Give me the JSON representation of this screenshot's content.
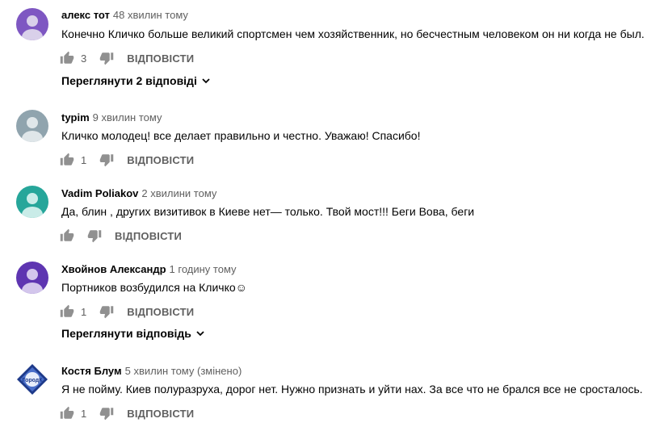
{
  "comments": [
    {
      "author": "алекс тот",
      "time": "48 хвилин тому",
      "edited": "",
      "text": "Конечно Кличко больше великий спортсмен чем хозяйственник, но бесчестным человеком он ни когда не был.",
      "likes": "3",
      "reply_label": "ВІДПОВІСТИ",
      "view_replies": "Переглянути 2 відповіді",
      "avatar_color": "#7e57c2",
      "avatar_icon": "person-icon"
    },
    {
      "author": "typim",
      "time": "9 хвилин тому",
      "edited": "",
      "text": "Кличко молодец! все делает правильно и честно. Уважаю! Спасибо!",
      "likes": "1",
      "reply_label": "ВІДПОВІСТИ",
      "avatar_color": "#90a4ae",
      "avatar_icon": "person-icon"
    },
    {
      "author": "Vadim Poliakov",
      "time": "2 хвилини тому",
      "edited": "",
      "text": "Да, блин , других визитивок в Киеве нет— только. Твой мост!!! Беги Вова, беги",
      "likes": "",
      "reply_label": "ВІДПОВІСТИ",
      "avatar_color": "#26a69a",
      "avatar_icon": "person-icon"
    },
    {
      "author": "Хвойнов Александр",
      "time": "1 годину тому",
      "edited": "",
      "text": "Портников возбудился на Кличко☺",
      "likes": "1",
      "reply_label": "ВІДПОВІСТИ",
      "view_replies": "Переглянути відповідь",
      "avatar_color": "#5e35b1",
      "avatar_icon": "person-icon"
    },
    {
      "author": "Костя Блум",
      "time": "5 хвилин тому",
      "edited": "(змінено)",
      "text": "Я не пойму. Киев полуразруха,  дорог нет. Нужно признать и уйти нах. За все что не брался все не  сросталось.",
      "likes": "1",
      "reply_label": "ВІДПОВІСТИ",
      "avatar_color": "#1e3a8a",
      "avatar_icon": "city-logo-icon",
      "avatar_logo_text": "Город К"
    }
  ],
  "colors": {
    "secondary_text": "#606060",
    "primary_text": "#030303",
    "icon": "#909090"
  }
}
